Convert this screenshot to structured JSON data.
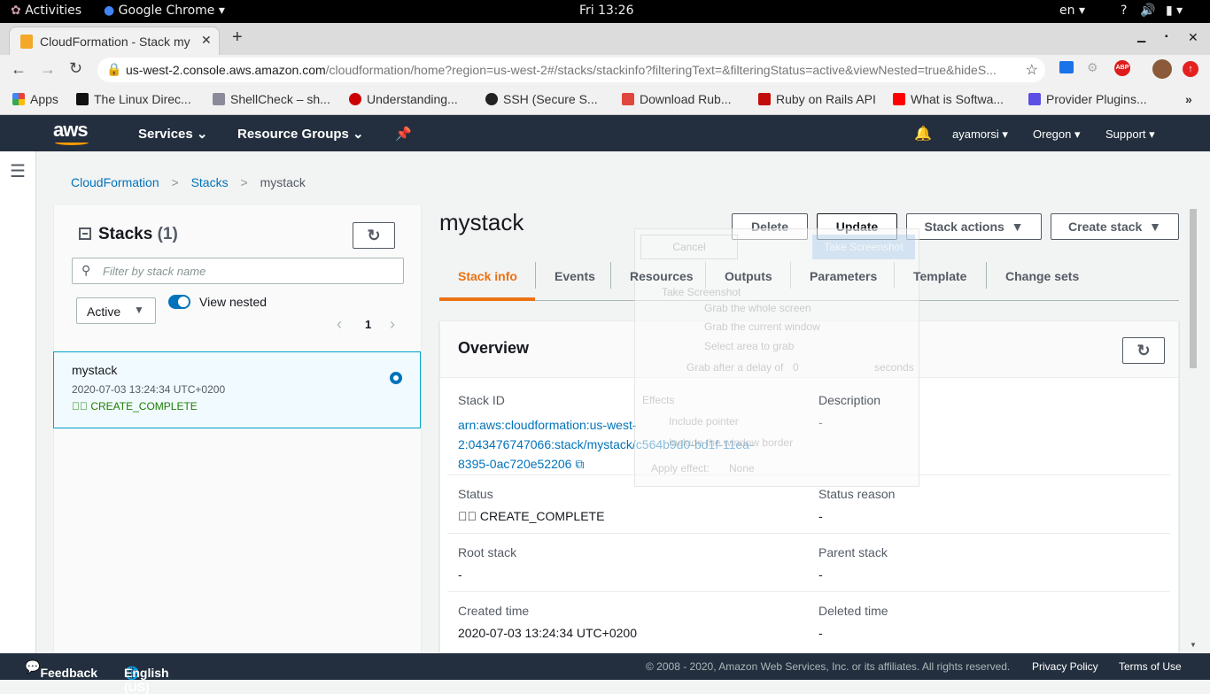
{
  "os": {
    "activities": "Activities",
    "app": "Google Chrome",
    "clock": "Fri 13:26",
    "lang": "en"
  },
  "browser": {
    "tab_title": "CloudFormation - Stack my",
    "url_host": "us-west-2.console.aws.amazon.com",
    "url_path": "/cloudformation/home?region=us-west-2#/stacks/stackinfo?filteringText=&filteringStatus=active&viewNested=true&hideS...",
    "bookmarks": [
      {
        "label": "Apps",
        "color": "#e94235"
      },
      {
        "label": "The Linux Direc...",
        "color": "#111"
      },
      {
        "label": "ShellCheck – sh...",
        "color": "#8a8a9a"
      },
      {
        "label": "Understanding...",
        "color": "#cc0000"
      },
      {
        "label": "SSH (Secure S...",
        "color": "#222"
      },
      {
        "label": "Download Rub...",
        "color": "#e0463c"
      },
      {
        "label": "Ruby on Rails API",
        "color": "#c30d0d"
      },
      {
        "label": "What is Softwa...",
        "color": "#ff0000"
      },
      {
        "label": "Provider Plugins...",
        "color": "#5c4ee5"
      }
    ],
    "more": "»"
  },
  "aws": {
    "logo": "aws",
    "services": "Services",
    "resource_groups": "Resource Groups",
    "user": "ayamorsi",
    "region": "Oregon",
    "support": "Support"
  },
  "breadcrumb": [
    "CloudFormation",
    "Stacks",
    "mystack"
  ],
  "stacks_panel": {
    "title": "Stacks",
    "count": "(1)",
    "filter_placeholder": "Filter by stack name",
    "status_filter": "Active",
    "view_nested": "View nested",
    "view_nested_on": true,
    "page": "1",
    "items": [
      {
        "name": "mystack",
        "time": "2020-07-03 13:24:34 UTC+0200",
        "status": "CREATE_COMPLETE"
      }
    ]
  },
  "detail": {
    "title": "mystack",
    "buttons": {
      "delete": "Delete",
      "update": "Update",
      "stack_actions": "Stack actions",
      "create_stack": "Create stack"
    },
    "tabs": [
      "Stack info",
      "Events",
      "Resources",
      "Outputs",
      "Parameters",
      "Template",
      "Change sets"
    ],
    "active_tab": "Stack info",
    "overview": {
      "title": "Overview",
      "stack_id_label": "Stack ID",
      "stack_id_lines": [
        "arn:aws:cloudformation:us-west-",
        "2:043476747066:stack/mystack/c564b9d0-bd1f-11ea-",
        "8395-0ac720e52206"
      ],
      "description_label": "Description",
      "description": "-",
      "status_label": "Status",
      "status": "CREATE_COMPLETE",
      "status_reason_label": "Status reason",
      "status_reason": "-",
      "root_stack_label": "Root stack",
      "root_stack": "-",
      "parent_stack_label": "Parent stack",
      "parent_stack": "-",
      "created_label": "Created time",
      "created": "2020-07-03 13:24:34 UTC+0200",
      "deleted_label": "Deleted time",
      "deleted": "-"
    }
  },
  "screenshot_dialog": {
    "cancel": "Cancel",
    "take": "Take Screenshot",
    "heading": "Take Screenshot",
    "opt1": "Grab the whole screen",
    "opt2": "Grab the current window",
    "opt3": "Select area to grab",
    "delay_label": "Grab after a delay of",
    "delay": "0",
    "seconds": "seconds",
    "effects": "Effects",
    "pointer": "Include pointer",
    "border": "Include the window border",
    "apply": "Apply effect:",
    "effect": "None"
  },
  "footer": {
    "feedback": "Feedback",
    "language": "English (US)",
    "copyright": "© 2008 - 2020, Amazon Web Services, Inc. or its affiliates. All rights reserved.",
    "privacy": "Privacy Policy",
    "terms": "Terms of Use"
  }
}
